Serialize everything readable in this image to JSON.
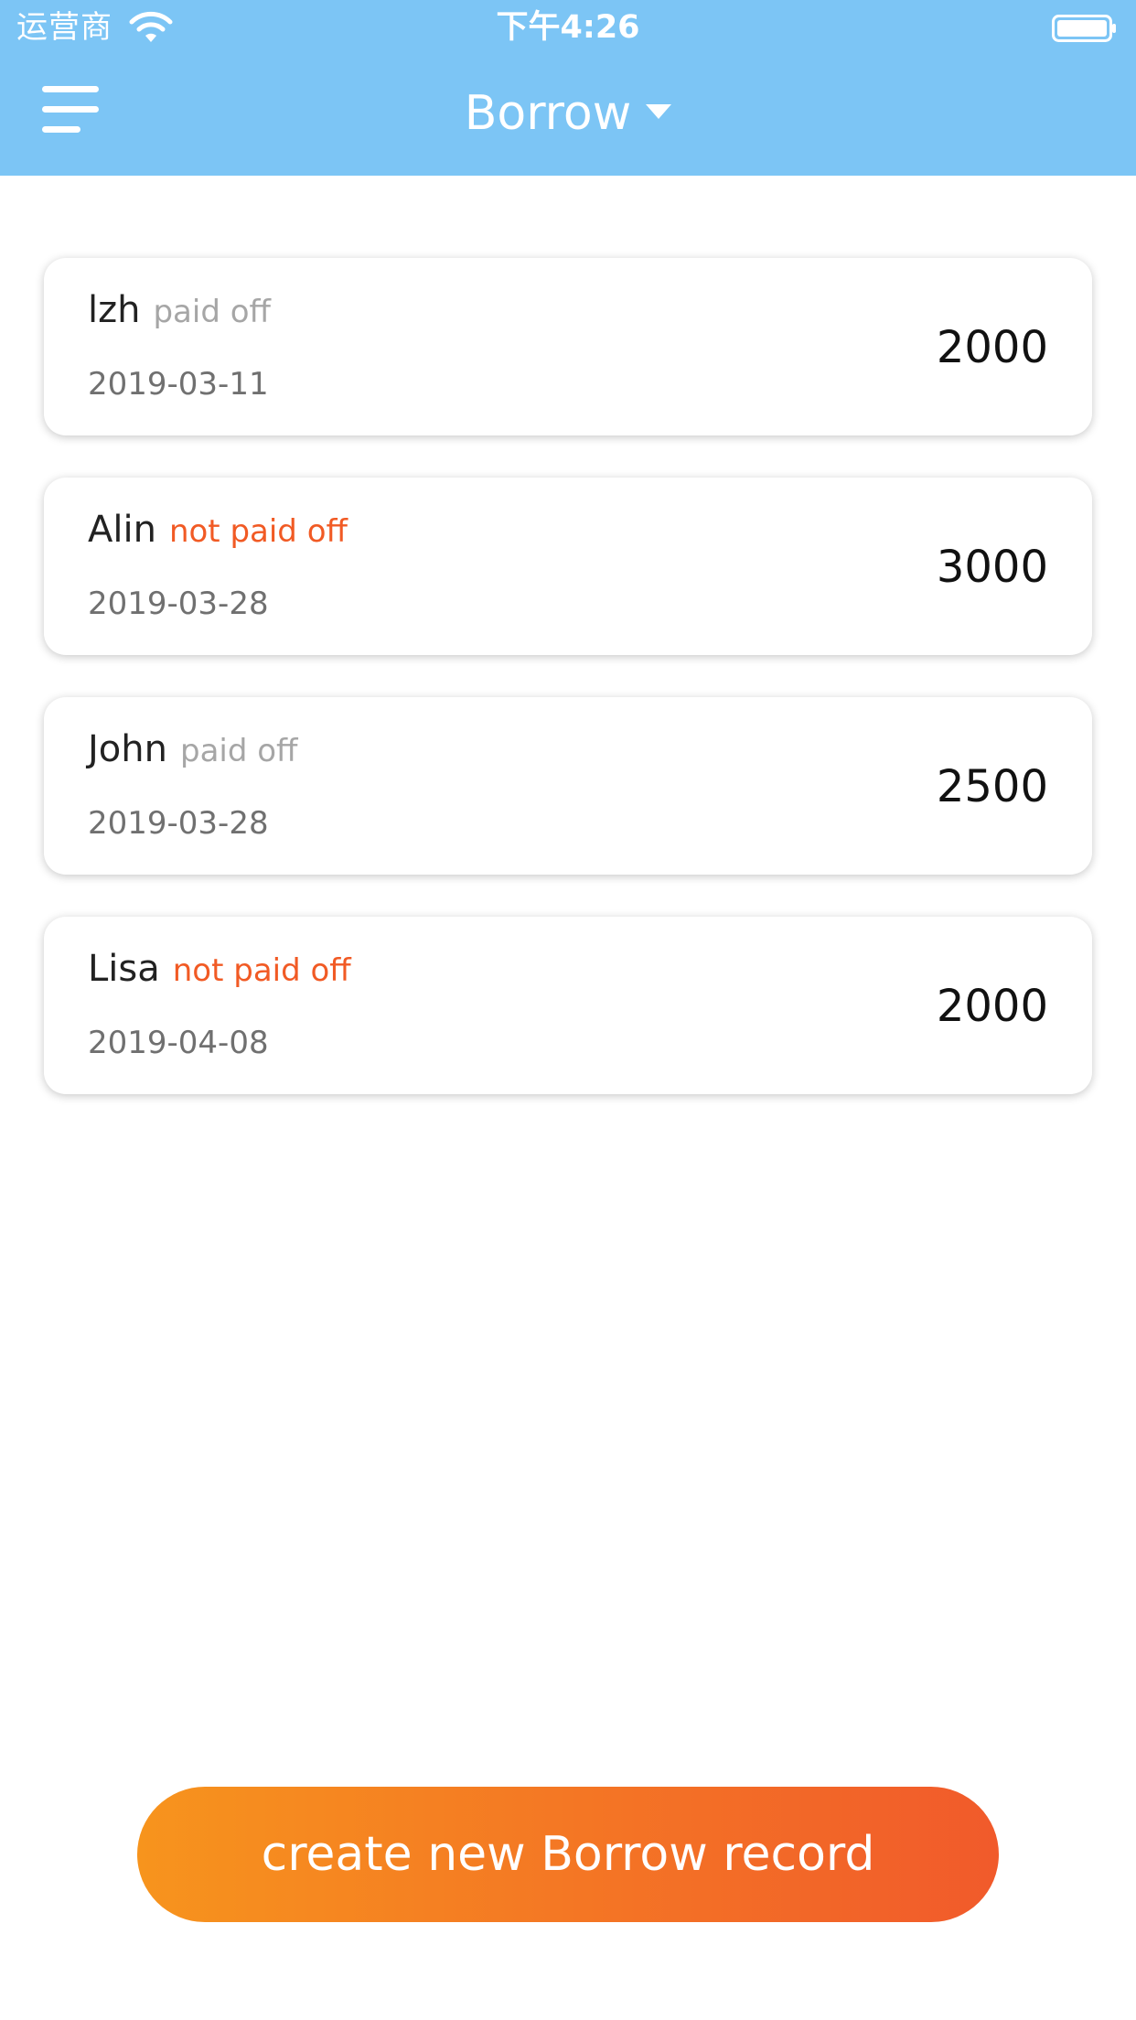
{
  "status_bar": {
    "carrier": "运营商",
    "time": "下午4:26"
  },
  "nav": {
    "title": "Borrow"
  },
  "records": [
    {
      "name": "lzh",
      "status": "paid off",
      "paid": true,
      "date": "2019-03-11",
      "amount": "2000"
    },
    {
      "name": "Alin",
      "status": "not paid off",
      "paid": false,
      "date": "2019-03-28",
      "amount": "3000"
    },
    {
      "name": "John",
      "status": "paid off",
      "paid": true,
      "date": "2019-03-28",
      "amount": "2500"
    },
    {
      "name": "Lisa",
      "status": "not paid off",
      "paid": false,
      "date": "2019-04-08",
      "amount": "2000"
    }
  ],
  "create_button": {
    "label": "create new Borrow record"
  },
  "colors": {
    "header": "#7cc5f5",
    "paid_status": "#a6a6a6",
    "unpaid_status": "#f15a24",
    "button_gradient_start": "#f7941d",
    "button_gradient_end": "#f15a2b"
  },
  "icons": {
    "menu": "hamburger-menu-icon",
    "dropdown": "caret-down-icon",
    "wifi": "wifi-icon",
    "battery": "battery-icon"
  }
}
